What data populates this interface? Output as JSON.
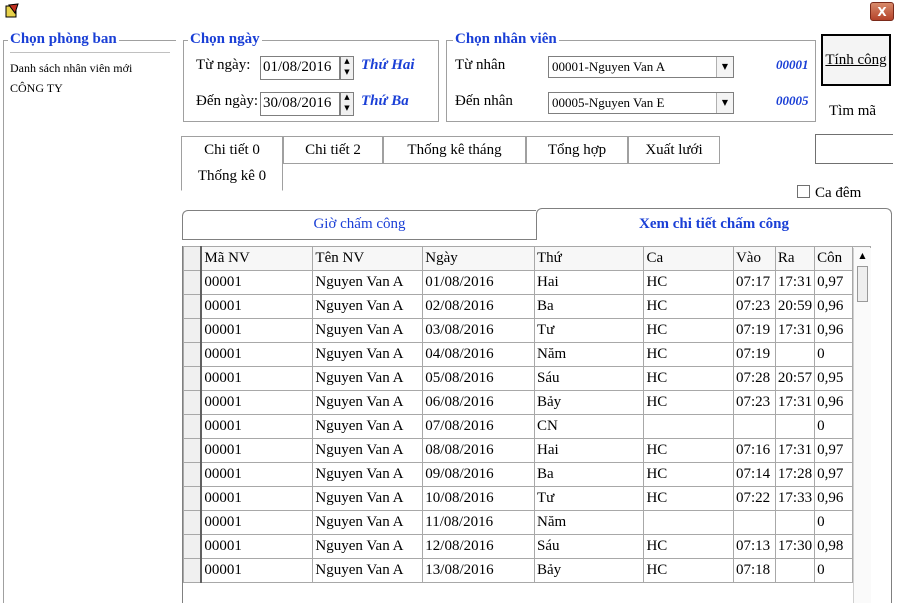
{
  "window": {
    "close_label": "X"
  },
  "dept": {
    "legend": "Chọn phòng ban",
    "items": [
      "Danh sách nhân viên mới",
      "CÔNG TY"
    ]
  },
  "date": {
    "legend": "Chọn ngày",
    "from_label": "Từ ngày:",
    "from_value": "01/08/2016",
    "from_day": "Thứ Hai",
    "to_label": "Đến ngày:",
    "to_value": "30/08/2016",
    "to_day": "Thứ Ba"
  },
  "emp": {
    "legend": "Chọn nhân viên",
    "from_label": "Từ nhân",
    "from_value": "00001-Nguyen Van A",
    "from_code": "00001",
    "to_label": "Đến nhân",
    "to_value": "00005-Nguyen Van E",
    "to_code": "00005"
  },
  "actions": {
    "tinh_cong": "Tính công",
    "tim_ma": "Tìm mã",
    "ca_dem": "Ca đêm"
  },
  "tabs": [
    "Chi tiết 0",
    "Chi tiết 2",
    "Thống kê tháng",
    "Tổng hợp",
    "Xuất lưới",
    "Thống kê 0"
  ],
  "subtabs": [
    "Giờ chấm công",
    "Xem chi tiết chấm công"
  ],
  "table": {
    "columns": [
      "Mã NV",
      "Tên NV",
      "Ngày",
      "Thứ",
      "Ca",
      "Vào",
      "Ra",
      "Côn"
    ],
    "rows": [
      [
        "00001",
        "Nguyen Van A",
        "01/08/2016",
        "Hai",
        "HC",
        "07:17",
        "17:31",
        "0,97"
      ],
      [
        "00001",
        "Nguyen Van A",
        "02/08/2016",
        "Ba",
        "HC",
        "07:23",
        "20:59",
        "0,96"
      ],
      [
        "00001",
        "Nguyen Van A",
        "03/08/2016",
        "Tư",
        "HC",
        "07:19",
        "17:31",
        "0,96"
      ],
      [
        "00001",
        "Nguyen Van A",
        "04/08/2016",
        "Năm",
        "HC",
        "07:19",
        "",
        "0"
      ],
      [
        "00001",
        "Nguyen Van A",
        "05/08/2016",
        "Sáu",
        "HC",
        "07:28",
        "20:57",
        "0,95"
      ],
      [
        "00001",
        "Nguyen Van A",
        "06/08/2016",
        "Bảy",
        "HC",
        "07:23",
        "17:31",
        "0,96"
      ],
      [
        "00001",
        "Nguyen Van A",
        "07/08/2016",
        "CN",
        "",
        "",
        "",
        "0"
      ],
      [
        "00001",
        "Nguyen Van A",
        "08/08/2016",
        "Hai",
        "HC",
        "07:16",
        "17:31",
        "0,97"
      ],
      [
        "00001",
        "Nguyen Van A",
        "09/08/2016",
        "Ba",
        "HC",
        "07:14",
        "17:28",
        "0,97"
      ],
      [
        "00001",
        "Nguyen Van A",
        "10/08/2016",
        "Tư",
        "HC",
        "07:22",
        "17:33",
        "0,96"
      ],
      [
        "00001",
        "Nguyen Van A",
        "11/08/2016",
        "Năm",
        "",
        "",
        "",
        "0"
      ],
      [
        "00001",
        "Nguyen Van A",
        "12/08/2016",
        "Sáu",
        "HC",
        "07:13",
        "17:30",
        "0,98"
      ],
      [
        "00001",
        "Nguyen Van A",
        "13/08/2016",
        "Bảy",
        "HC",
        "07:18",
        "",
        "0"
      ]
    ]
  }
}
